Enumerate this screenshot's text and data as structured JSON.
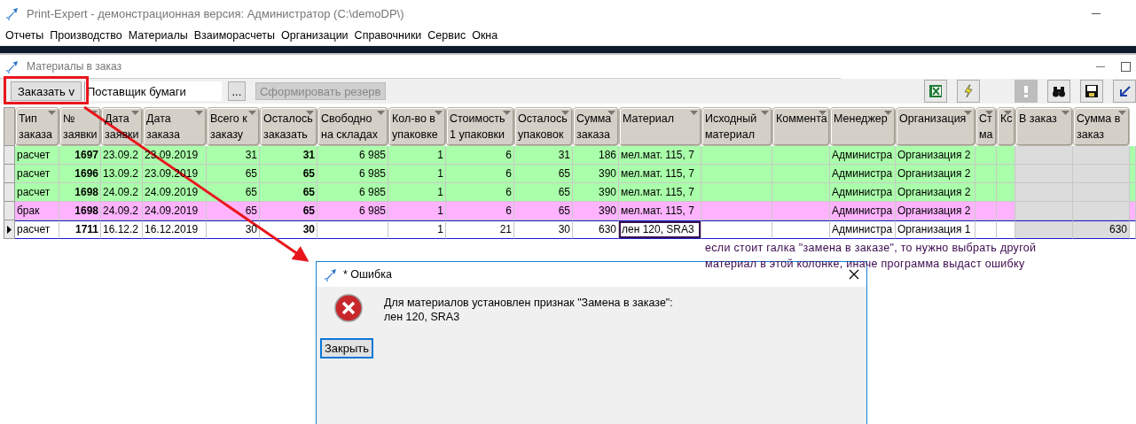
{
  "window": {
    "title": "Print-Expert - демонстрационная версия: Администратор (C:\\demoDP\\)"
  },
  "menu": [
    "Отчеты",
    "Производство",
    "Материалы",
    "Взаиморасчеты",
    "Организации",
    "Справочники",
    "Сервис",
    "Окна"
  ],
  "child_window": {
    "title": "Материалы в заказ"
  },
  "toolbar": {
    "order_button": "Заказать v",
    "supplier_field": {
      "value": "Поставщик бумаги"
    },
    "browse_button": "...",
    "reserve_button": {
      "label": "Сформировать резерв",
      "disabled": true
    },
    "icons": [
      {
        "kind": "excel",
        "disabled": false
      },
      {
        "kind": "lightning",
        "disabled": false
      },
      {
        "kind": "mark",
        "disabled": true
      },
      {
        "kind": "binoculars",
        "disabled": false
      },
      {
        "kind": "save",
        "disabled": false
      },
      {
        "kind": "back",
        "disabled": false
      }
    ]
  },
  "table": {
    "columns": [
      {
        "label": "Тип заказа",
        "kind": "text",
        "bold": false,
        "shaded": false
      },
      {
        "label": "№ заявки",
        "kind": "number",
        "bold": true,
        "shaded": false
      },
      {
        "label": "Дата заявки",
        "kind": "text",
        "bold": false,
        "shaded": false
      },
      {
        "label": "Дата заказа",
        "kind": "text",
        "bold": false,
        "shaded": false
      },
      {
        "label": "Всего к заказу",
        "kind": "number",
        "bold": false,
        "shaded": false
      },
      {
        "label": "Осталось заказать",
        "kind": "number",
        "bold": true,
        "shaded": false
      },
      {
        "label": "Свободно на складах",
        "kind": "number",
        "bold": false,
        "shaded": false
      },
      {
        "label": "Кол-во в упаковке",
        "kind": "number",
        "bold": false,
        "shaded": false
      },
      {
        "label": "Стоимость 1 упаковки",
        "kind": "number",
        "bold": false,
        "shaded": false
      },
      {
        "label": "Осталось упаковок",
        "kind": "number",
        "bold": false,
        "shaded": false
      },
      {
        "label": "Сумма заказа",
        "kind": "number",
        "bold": false,
        "shaded": false
      },
      {
        "label": "Материал",
        "kind": "text",
        "bold": false,
        "shaded": false
      },
      {
        "label": "Исходный материал",
        "kind": "text",
        "bold": false,
        "shaded": false
      },
      {
        "label": "Коммента",
        "kind": "text",
        "bold": false,
        "shaded": false
      },
      {
        "label": "Менеджер",
        "kind": "text",
        "bold": false,
        "shaded": false
      },
      {
        "label": "Организация",
        "kind": "text",
        "bold": false,
        "shaded": false
      },
      {
        "label": "Ст ма",
        "kind": "text",
        "bold": false,
        "shaded": false
      },
      {
        "label": "Кс",
        "kind": "text",
        "bold": false,
        "shaded": false
      },
      {
        "label": "В заказ",
        "kind": "number",
        "bold": false,
        "shaded": true
      },
      {
        "label": "Сумма в заказ",
        "kind": "number",
        "bold": false,
        "shaded": true
      }
    ],
    "rows": [
      {
        "color": "#aaffaa",
        "selected": false,
        "material_flagged": false,
        "cells": [
          "расчет",
          "1697",
          "23.09.2",
          "23.09.2019",
          "31",
          "31",
          "6 985",
          "1",
          "6",
          "31",
          "186",
          "мел.мат. 115, 7",
          null,
          null,
          "Администра",
          "Организация 2",
          null,
          null,
          null,
          null
        ]
      },
      {
        "color": "#aaffaa",
        "selected": false,
        "material_flagged": false,
        "cells": [
          "расчет",
          "1696",
          "13.09.2",
          "23.09.2019",
          "65",
          "65",
          "6 985",
          "1",
          "6",
          "65",
          "390",
          "мел.мат. 115, 7",
          null,
          null,
          "Администра",
          "Организация 2",
          null,
          null,
          null,
          null
        ]
      },
      {
        "color": "#aaffaa",
        "selected": false,
        "material_flagged": false,
        "cells": [
          "расчет",
          "1698",
          "24.09.2",
          "24.09.2019",
          "65",
          "65",
          "6 985",
          "1",
          "6",
          "65",
          "390",
          "мел.мат. 115, 7",
          null,
          null,
          "Администра",
          "Организация 2",
          null,
          null,
          null,
          null
        ]
      },
      {
        "color": "#ffb3ff",
        "selected": false,
        "material_flagged": false,
        "cells": [
          "брак",
          "1698",
          "24.09.2",
          "24.09.2019",
          "65",
          "65",
          "6 985",
          "1",
          "6",
          "65",
          "390",
          "мел.мат. 115, 7",
          null,
          null,
          "Администра",
          "Организация 2",
          null,
          null,
          null,
          null
        ]
      },
      {
        "color": "#ffffff",
        "selected": true,
        "material_flagged": true,
        "cells": [
          "расчет",
          "1711",
          "16.12.2",
          "16.12.2019",
          "30",
          "30",
          null,
          "1",
          "21",
          "30",
          "630",
          "лен 120, SRA3",
          null,
          null,
          "Администра",
          "Организация 1",
          null,
          null,
          null,
          "630"
        ]
      }
    ]
  },
  "note": "если стоит галка \"замена в заказе\", то нужно выбрать другой материал в этой колонке, иначе программа выдаст ошибку",
  "dialog": {
    "title": "* Ошибка",
    "message": [
      "Для материалов установлен признак \"Замена в заказе\":",
      "лен 120, SRA3"
    ],
    "button": "Закрыть"
  }
}
